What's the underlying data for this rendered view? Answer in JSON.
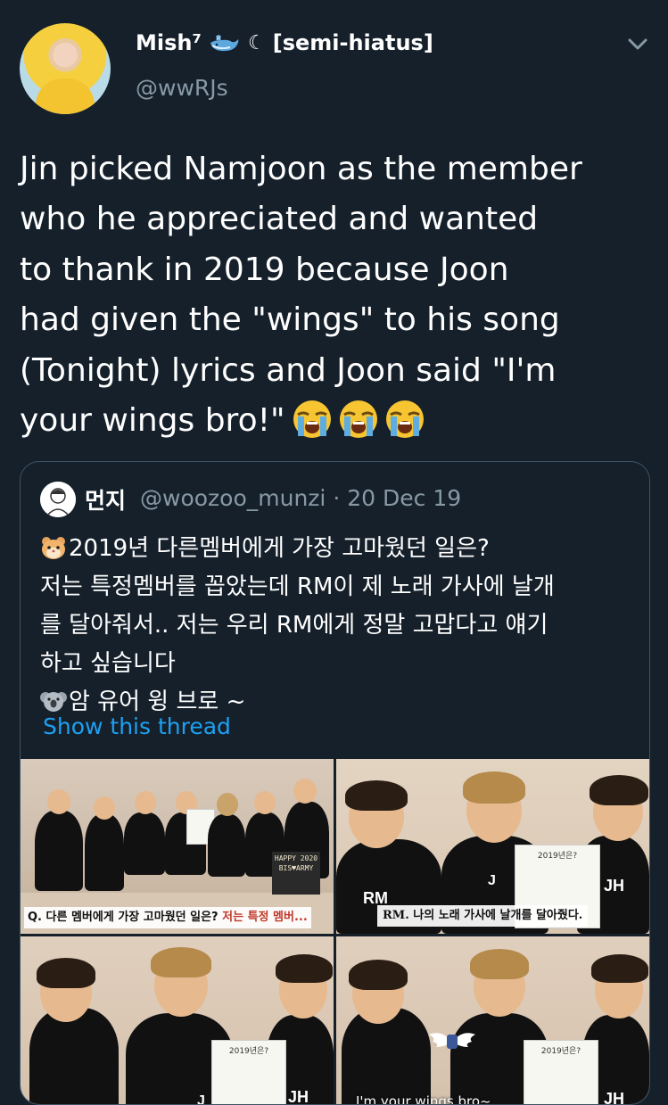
{
  "author": {
    "display_name": "Mish⁷",
    "moon_glyph": "☾",
    "status": "[semi-hiatus]",
    "handle": "@wwRJs"
  },
  "tweet": {
    "text": "Jin picked Namjoon as the member\nwho he appreciated and wanted\nto thank in 2019 because Joon\nhad given the \"wings\" to his song\n(Tonight) lyrics and Joon said \"I'm\nyour wings bro!\""
  },
  "quote": {
    "name": "먼지",
    "handle": "@woozoo_munzi",
    "separator": "·",
    "date": "20 Dec 19",
    "lines": [
      "2019년 다른멤버에게 가장 고마웠던 일은?",
      "저는 특정멤버를 꼽았는데 RM이 제 노래 가사에 날개",
      "를 달아줘서.. 저는 우리 RM에게 정말 고맙다고 얘기",
      "하고 싶습니다",
      "암 유어 윙 브로 ~"
    ],
    "show_thread": "Show this thread"
  },
  "media": {
    "photo1_caption_q": "Q. 다른 멤버에게 가장 고마웠던 일은?",
    "photo1_caption_tail": "저는 특정 멤버...",
    "photo1_sign": "HAPPY 2020 BIS♥ARMY",
    "photo2_caption": "RM. 나의 노래 가사에 날개를 달아줬다.",
    "photo2_board_title": "2019년은?",
    "photo2_shirt_rm": "RM",
    "photo2_shirt_j": "J",
    "photo2_shirt_jh": "JH",
    "photo3_shirt_j": "J",
    "photo3_shirt_jh": "JH",
    "photo3_board_title": "2019년은?",
    "photo4_sub": "I'm your wings bro~",
    "photo4_shirt_jh": "JH",
    "photo4_board_title": "2019년은?"
  },
  "icons": {
    "whale": "whale-icon",
    "moon": "crescent-moon-icon",
    "cry": "loudly-crying-face-icon",
    "hamster": "hamster-face-icon",
    "koala": "koala-face-icon",
    "chevron": "chevron-down-icon"
  },
  "colors": {
    "background": "#15202b",
    "secondary_text": "#8899a6",
    "link": "#1da1f2",
    "border": "#3d5466"
  }
}
